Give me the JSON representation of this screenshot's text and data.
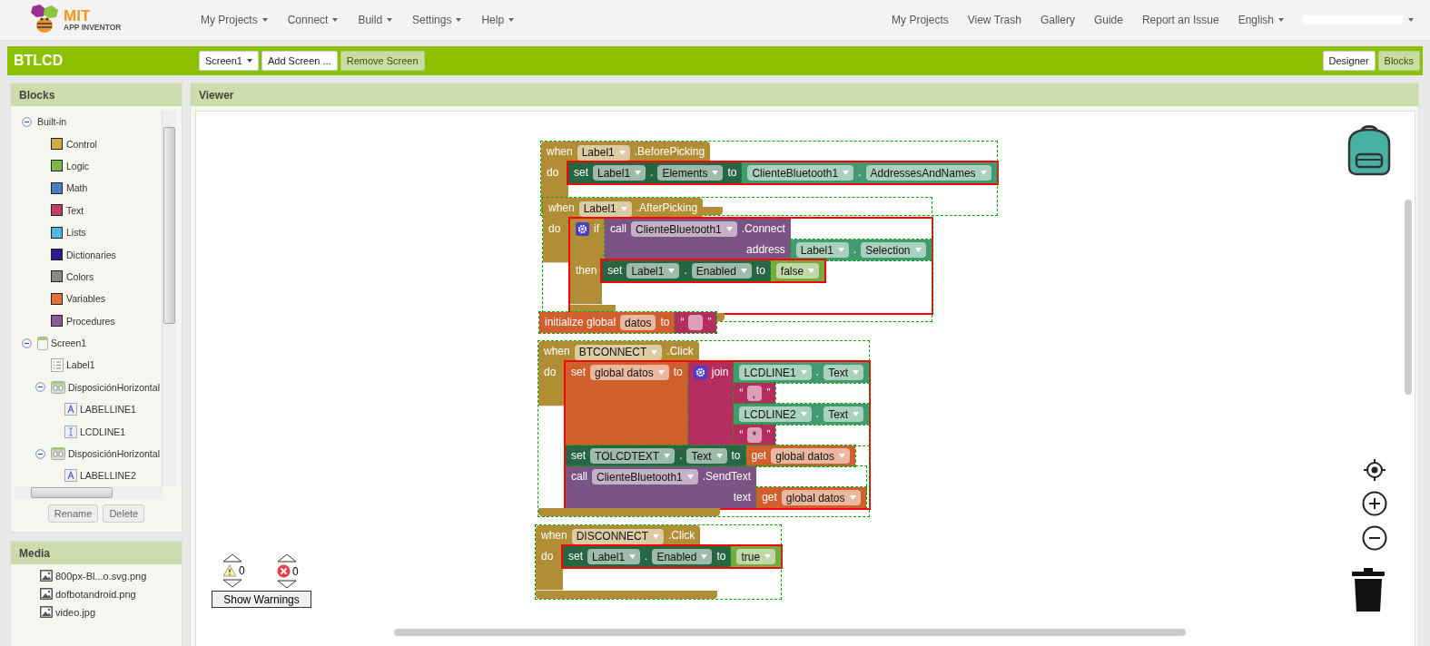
{
  "top_bar": {
    "logo": {
      "line1": "MIT",
      "line2": "APP INVENTOR"
    },
    "menus": [
      "My Projects",
      "Connect",
      "Build",
      "Settings",
      "Help"
    ],
    "links": [
      "My Projects",
      "View Trash",
      "Gallery",
      "Guide",
      "Report an Issue"
    ],
    "language": "English"
  },
  "project_bar": {
    "name": "BTLCD",
    "screen": "Screen1",
    "buttons": [
      {
        "label": "Add Screen ...",
        "disabled": false
      },
      {
        "label": "Remove Screen",
        "disabled": true
      }
    ],
    "editors": [
      {
        "label": "Designer",
        "selected": false
      },
      {
        "label": "Blocks",
        "selected": true
      }
    ]
  },
  "blocks_panel": {
    "title": "Blocks",
    "tree": [
      {
        "label": "Built-in",
        "expanded": true,
        "children": [
          {
            "label": "Control",
            "color": "#d4aa45"
          },
          {
            "label": "Logic",
            "color": "#7fb744"
          },
          {
            "label": "Math",
            "color": "#4a7fc1"
          },
          {
            "label": "Text",
            "color": "#c33d6b"
          },
          {
            "label": "Lists",
            "color": "#4db8e0"
          },
          {
            "label": "Dictionaries",
            "color": "#2b1a8f"
          },
          {
            "label": "Colors",
            "color": "#8a8a8a"
          },
          {
            "label": "Variables",
            "color": "#e0733a"
          },
          {
            "label": "Procedures",
            "color": "#8b5c9a"
          }
        ]
      },
      {
        "label": "Screen1",
        "kind": "screen",
        "expanded": true,
        "children": [
          {
            "label": "Label1",
            "kind": "list_picker"
          },
          {
            "label": "DisposiciónHorizontal",
            "kind": "arrangement",
            "expanded": true,
            "children": [
              {
                "label": "LABELLINE1",
                "kind": "label"
              },
              {
                "label": "LCDLINE1",
                "kind": "textbox"
              }
            ]
          },
          {
            "label": "DisposiciónHorizontal",
            "kind": "arrangement",
            "expanded": true,
            "children": [
              {
                "label": "LABELLINE2",
                "kind": "label"
              }
            ]
          }
        ]
      }
    ],
    "buttons": [
      "Rename",
      "Delete"
    ]
  },
  "media_panel": {
    "title": "Media",
    "files": [
      "800px-Bl...o.svg.png",
      "dofbotandroid.png",
      "video.jpg"
    ]
  },
  "viewer": {
    "title": "Viewer",
    "warnings": {
      "warning_count": "0",
      "error_count": "0",
      "button": "Show Warnings"
    },
    "blocks": [
      {
        "kind": "event",
        "rows": [
          {
            "kind": "head",
            "items": [
              {
                "kind": "label",
                "text": "when"
              },
              {
                "kind": "dropdown",
                "text": "Label1"
              },
              {
                "kind": "label",
                "text": ".BeforePicking"
              }
            ]
          },
          {
            "kind": "statement",
            "label": "do",
            "blocks": [
              {
                "kind": "set",
                "rows": [
                  {
                    "kind": "line",
                    "items": [
                      {
                        "kind": "label",
                        "text": "set"
                      },
                      {
                        "kind": "dropdown",
                        "text": "Label1"
                      },
                      {
                        "kind": "label",
                        "text": "."
                      },
                      {
                        "kind": "dropdown",
                        "text": "Elements"
                      },
                      {
                        "kind": "label",
                        "text": "to"
                      }
                    ],
                    "input": {
                      "kind": "get",
                      "rows": [
                        {
                          "kind": "line",
                          "items": [
                            {
                              "kind": "dropdown",
                              "text": "ClienteBluetooth1"
                            },
                            {
                              "kind": "label",
                              "text": "."
                            },
                            {
                              "kind": "dropdown",
                              "text": "AddressesAndNames"
                            }
                          ]
                        }
                      ]
                    }
                  }
                ]
              }
            ]
          }
        ]
      },
      {
        "kind": "event",
        "rows": [
          {
            "kind": "head",
            "items": [
              {
                "kind": "label",
                "text": "when"
              },
              {
                "kind": "dropdown",
                "text": "Label1"
              },
              {
                "kind": "label",
                "text": ".AfterPicking"
              }
            ]
          },
          {
            "kind": "statement",
            "label": "do",
            "blocks": [
              {
                "kind": "if",
                "rows": [
                  {
                    "kind": "line",
                    "items": [
                      {
                        "kind": "gear"
                      },
                      {
                        "kind": "label",
                        "text": "if"
                      }
                    ],
                    "input": {
                      "kind": "call",
                      "rows": [
                        {
                          "kind": "line",
                          "items": [
                            {
                              "kind": "label",
                              "text": "call"
                            },
                            {
                              "kind": "dropdown",
                              "text": "ClienteBluetooth1"
                            },
                            {
                              "kind": "label",
                              "text": ".Connect"
                            }
                          ]
                        },
                        {
                          "kind": "line",
                          "items": [
                            {
                              "kind": "label",
                              "text": "address"
                            }
                          ],
                          "input": {
                            "kind": "get",
                            "rows": [
                              {
                                "kind": "line",
                                "items": [
                                  {
                                    "kind": "dropdown",
                                    "text": "Label1"
                                  },
                                  {
                                    "kind": "label",
                                    "text": "."
                                  },
                                  {
                                    "kind": "dropdown",
                                    "text": "Selection"
                                  }
                                ]
                              }
                            ]
                          }
                        }
                      ]
                    }
                  },
                  {
                    "kind": "statement",
                    "label": "then",
                    "blocks": [
                      {
                        "kind": "set",
                        "rows": [
                          {
                            "kind": "line",
                            "items": [
                              {
                                "kind": "label",
                                "text": "set"
                              },
                              {
                                "kind": "dropdown",
                                "text": "Label1"
                              },
                              {
                                "kind": "label",
                                "text": "."
                              },
                              {
                                "kind": "dropdown",
                                "text": "Enabled"
                              },
                              {
                                "kind": "label",
                                "text": "to"
                              }
                            ],
                            "input": {
                              "kind": "logic",
                              "rows": [
                                {
                                  "kind": "line",
                                  "items": [
                                    {
                                      "kind": "dropdown",
                                      "text": "false"
                                    }
                                  ]
                                }
                              ]
                            }
                          }
                        ]
                      }
                    ]
                  }
                ]
              }
            ]
          }
        ]
      },
      {
        "kind": "init",
        "rows": [
          {
            "kind": "line",
            "items": [
              {
                "kind": "label",
                "text": "initialize global"
              },
              {
                "kind": "field",
                "text": "datos"
              },
              {
                "kind": "label",
                "text": "to"
              }
            ],
            "input": {
              "kind": "text",
              "rows": [
                {
                  "kind": "line",
                  "items": [
                    {
                      "kind": "label",
                      "text": "“"
                    },
                    {
                      "kind": "field"
                    },
                    {
                      "kind": "label",
                      "text": "”"
                    }
                  ]
                }
              ]
            }
          }
        ]
      },
      {
        "kind": "event",
        "rows": [
          {
            "kind": "head",
            "items": [
              {
                "kind": "label",
                "text": "when"
              },
              {
                "kind": "dropdown",
                "text": "BTCONNECT"
              },
              {
                "kind": "label",
                "text": ".Click"
              }
            ]
          },
          {
            "kind": "statement",
            "label": "do",
            "blocks": [
              {
                "kind": "var_set",
                "rows": [
                  {
                    "kind": "line",
                    "items": [
                      {
                        "kind": "label",
                        "text": "set"
                      },
                      {
                        "kind": "dropdown",
                        "text": "global datos"
                      },
                      {
                        "kind": "label",
                        "text": "to"
                      }
                    ],
                    "input": {
                      "kind": "join",
                      "rows": [
                        {
                          "kind": "line",
                          "items": [
                            {
                              "kind": "gear"
                            },
                            {
                              "kind": "label",
                              "text": "join"
                            }
                          ],
                          "input": {
                            "kind": "get",
                            "rows": [
                              {
                                "kind": "line",
                                "items": [
                                  {
                                    "kind": "dropdown",
                                    "text": "LCDLINE1"
                                  },
                                  {
                                    "kind": "label",
                                    "text": "."
                                  },
                                  {
                                    "kind": "dropdown",
                                    "text": "Text"
                                  }
                                ]
                              }
                            ]
                          }
                        },
                        {
                          "kind": "line",
                          "input": {
                            "kind": "text",
                            "rows": [
                              {
                                "kind": "line",
                                "items": [
                                  {
                                    "kind": "label",
                                    "text": "“"
                                  },
                                  {
                                    "kind": "field",
                                    "text": ","
                                  },
                                  {
                                    "kind": "label",
                                    "text": "”"
                                  }
                                ]
                              }
                            ]
                          }
                        },
                        {
                          "kind": "line",
                          "input": {
                            "kind": "get",
                            "rows": [
                              {
                                "kind": "line",
                                "items": [
                                  {
                                    "kind": "dropdown",
                                    "text": "LCDLINE2"
                                  },
                                  {
                                    "kind": "label",
                                    "text": "."
                                  },
                                  {
                                    "kind": "dropdown",
                                    "text": "Text"
                                  }
                                ]
                              }
                            ]
                          }
                        },
                        {
                          "kind": "line",
                          "input": {
                            "kind": "text",
                            "rows": [
                              {
                                "kind": "line",
                                "items": [
                                  {
                                    "kind": "label",
                                    "text": "“"
                                  },
                                  {
                                    "kind": "field",
                                    "text": "*"
                                  },
                                  {
                                    "kind": "label",
                                    "text": "”"
                                  }
                                ]
                              }
                            ]
                          }
                        }
                      ]
                    }
                  }
                ]
              },
              {
                "kind": "set",
                "rows": [
                  {
                    "kind": "line",
                    "items": [
                      {
                        "kind": "label",
                        "text": "set"
                      },
                      {
                        "kind": "dropdown",
                        "text": "TOLCDTEXT"
                      },
                      {
                        "kind": "label",
                        "text": "."
                      },
                      {
                        "kind": "dropdown",
                        "text": "Text"
                      },
                      {
                        "kind": "label",
                        "text": "to"
                      }
                    ],
                    "input": {
                      "kind": "var_get",
                      "rows": [
                        {
                          "kind": "line",
                          "items": [
                            {
                              "kind": "label",
                              "text": "get"
                            },
                            {
                              "kind": "dropdown",
                              "text": "global datos"
                            }
                          ]
                        }
                      ]
                    }
                  }
                ]
              },
              {
                "kind": "call",
                "rows": [
                  {
                    "kind": "line",
                    "items": [
                      {
                        "kind": "label",
                        "text": "call"
                      },
                      {
                        "kind": "dropdown",
                        "text": "ClienteBluetooth1"
                      },
                      {
                        "kind": "label",
                        "text": ".SendText"
                      }
                    ]
                  },
                  {
                    "kind": "line",
                    "items": [
                      {
                        "kind": "label",
                        "text": "text"
                      }
                    ],
                    "input": {
                      "kind": "var_get",
                      "rows": [
                        {
                          "kind": "line",
                          "items": [
                            {
                              "kind": "label",
                              "text": "get"
                            },
                            {
                              "kind": "dropdown",
                              "text": "global datos"
                            }
                          ]
                        }
                      ]
                    }
                  }
                ]
              }
            ]
          }
        ]
      },
      {
        "kind": "event",
        "rows": [
          {
            "kind": "head",
            "items": [
              {
                "kind": "label",
                "text": "when"
              },
              {
                "kind": "dropdown",
                "text": "DISCONNECT"
              },
              {
                "kind": "label",
                "text": ".Click"
              }
            ]
          },
          {
            "kind": "statement",
            "label": "do",
            "blocks": [
              {
                "kind": "set",
                "rows": [
                  {
                    "kind": "line",
                    "items": [
                      {
                        "kind": "label",
                        "text": "set"
                      },
                      {
                        "kind": "dropdown",
                        "text": "Label1"
                      },
                      {
                        "kind": "label",
                        "text": "."
                      },
                      {
                        "kind": "dropdown",
                        "text": "Enabled"
                      },
                      {
                        "kind": "label",
                        "text": "to"
                      }
                    ],
                    "input": {
                      "kind": "logic",
                      "rows": [
                        {
                          "kind": "line",
                          "items": [
                            {
                              "kind": "dropdown",
                              "text": "true"
                            }
                          ]
                        }
                      ]
                    }
                  }
                ]
              }
            ]
          }
        ]
      }
    ]
  }
}
